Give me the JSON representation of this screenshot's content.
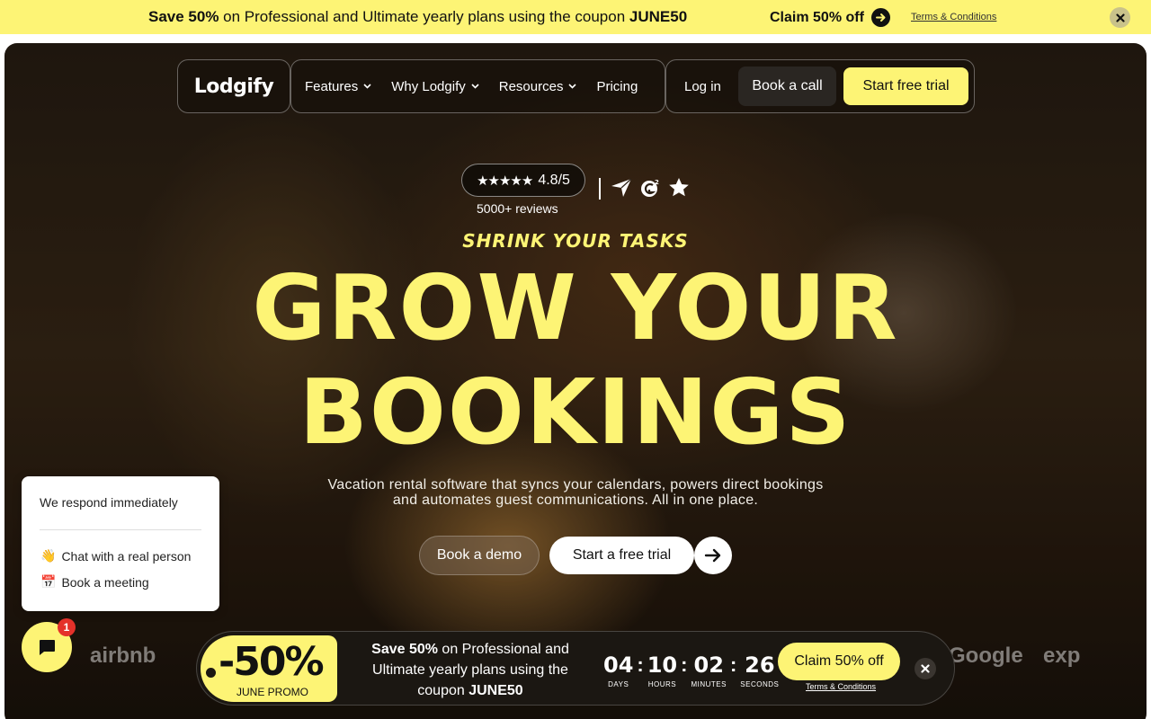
{
  "top_banner": {
    "lead": "Save 50%",
    "text": " on Professional and Ultimate yearly plans using the coupon ",
    "coupon": "JUNE50",
    "claim_label": "Claim 50% off",
    "terms_label": "Terms & Conditions",
    "close_icon": "close-icon"
  },
  "nav": {
    "logo": "Lodgify",
    "items": [
      {
        "label": "Features",
        "dropdown": true
      },
      {
        "label": "Why Lodgify",
        "dropdown": true
      },
      {
        "label": "Resources",
        "dropdown": true
      },
      {
        "label": "Pricing",
        "dropdown": false
      }
    ],
    "login_label": "Log in",
    "book_call_label": "Book a call",
    "free_trial_label": "Start free trial"
  },
  "rating": {
    "score": "4.8/5",
    "reviews": "5000+ reviews",
    "stars": "★★★★★",
    "badges": [
      "capterra-icon",
      "g2-icon",
      "star-icon"
    ]
  },
  "hero": {
    "eyebrow": "SHRINK YOUR TASKS",
    "headline_line1": "GROW YOUR",
    "headline_line2": "BOOKINGS",
    "subtitle_line1": "Vacation rental software that syncs your calendars, powers direct bookings",
    "subtitle_line2": "and automates guest communications. All in one place.",
    "demo_label": "Book a demo",
    "trial_label": "Start a free trial"
  },
  "partners": [
    "airbnb",
    "Google",
    "exp"
  ],
  "chat": {
    "title": "We respond immediately",
    "options": [
      {
        "emoji": "👋",
        "label": "Chat with a real person"
      },
      {
        "emoji": "📅",
        "label": "Book a meeting"
      }
    ],
    "unread": "1"
  },
  "promo_bar": {
    "discount": "-50%",
    "tag_label": "JUNE PROMO",
    "lead": "Save 50%",
    "text": " on Professional and Ultimate yearly plans using the coupon ",
    "coupon": "JUNE50",
    "countdown": [
      {
        "value": "04",
        "label": "DAYS"
      },
      {
        "value": "10",
        "label": "HOURS"
      },
      {
        "value": "02",
        "label": "MINUTES"
      },
      {
        "value": "26",
        "label": "SECONDS"
      }
    ],
    "claim_label": "Claim 50% off",
    "terms_label": "Terms & Conditions"
  },
  "colors": {
    "accent": "#fdf475",
    "dark": "#1b1712"
  }
}
